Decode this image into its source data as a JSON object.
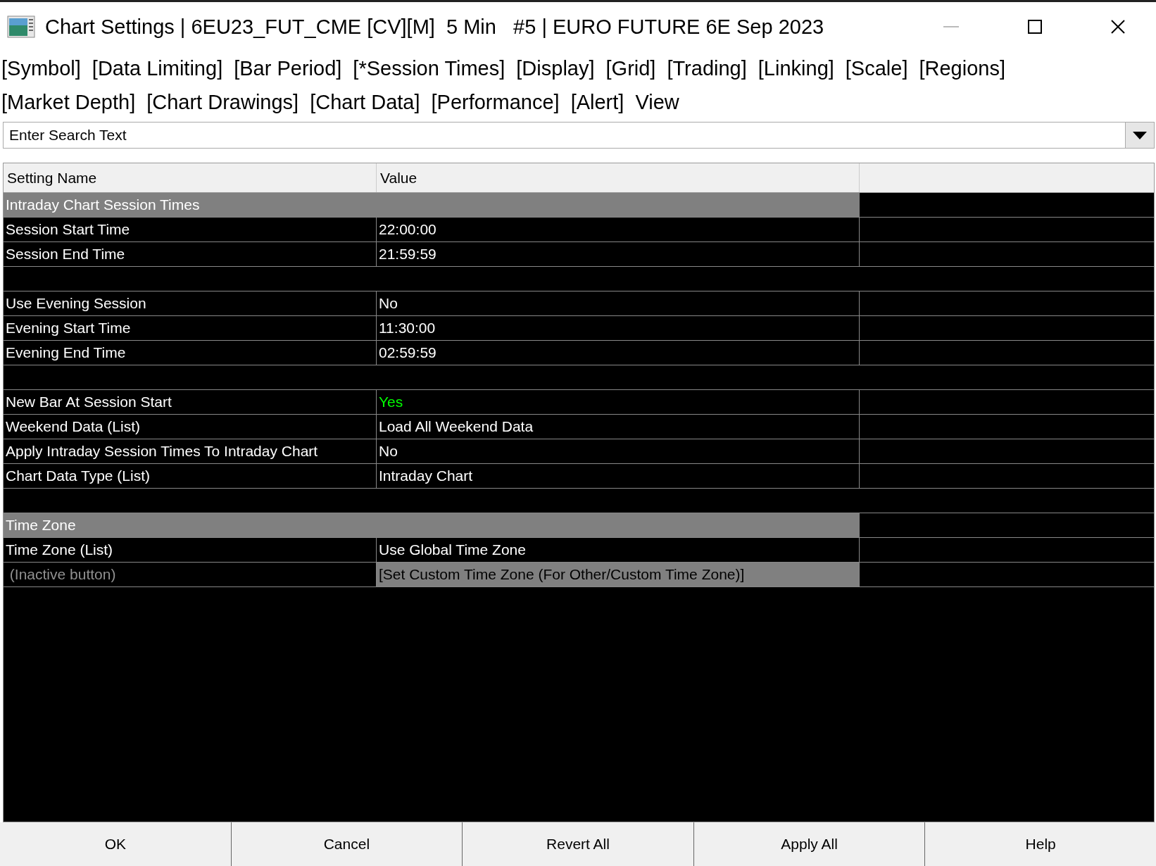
{
  "window": {
    "title": "Chart Settings | 6EU23_FUT_CME [CV][M]  5 Min   #5 | EURO FUTURE 6E Sep 2023"
  },
  "tab_rows": [
    [
      "[Symbol]",
      "[Data Limiting]",
      "[Bar Period]",
      "[*Session Times]",
      "[Display]",
      "[Grid]",
      "[Trading]",
      "[Linking]",
      "[Scale]",
      "[Regions]"
    ],
    [
      "[Market Depth]",
      "[Chart Drawings]",
      "[Chart Data]",
      "[Performance]",
      "[Alert]",
      "View"
    ]
  ],
  "search": {
    "placeholder": "Enter Search Text"
  },
  "table": {
    "columns": [
      "Setting Name",
      "Value"
    ],
    "rows": [
      {
        "kind": "section",
        "name": "Intraday Chart Session Times"
      },
      {
        "kind": "setting",
        "name": "Session Start Time",
        "value": "22:00:00",
        "color": "#ffffff"
      },
      {
        "kind": "setting",
        "name": "Session End Time",
        "value": "21:59:59",
        "color": "#ffffff"
      },
      {
        "kind": "blank"
      },
      {
        "kind": "setting",
        "name": "Use Evening Session",
        "value": "No",
        "color": "#ffffff"
      },
      {
        "kind": "setting",
        "name": "Evening Start Time",
        "value": "11:30:00",
        "color": "#ffffff"
      },
      {
        "kind": "setting",
        "name": "Evening End Time",
        "value": "02:59:59",
        "color": "#ffffff"
      },
      {
        "kind": "blank"
      },
      {
        "kind": "setting",
        "name": "New Bar At Session Start",
        "value": "Yes",
        "color": "#00ff00"
      },
      {
        "kind": "setting",
        "name": "Weekend Data (List)",
        "value": "Load All Weekend Data",
        "color": "#ffffff"
      },
      {
        "kind": "setting",
        "name": "Apply Intraday Session Times To Intraday Chart",
        "value": "No",
        "color": "#ffffff"
      },
      {
        "kind": "setting",
        "name": "Chart Data Type (List)",
        "value": "Intraday Chart",
        "color": "#ffffff"
      },
      {
        "kind": "blank"
      },
      {
        "kind": "section",
        "name": "Time Zone"
      },
      {
        "kind": "setting",
        "name": "Time Zone (List)",
        "value": "Use Global Time Zone",
        "color": "#ffffff"
      },
      {
        "kind": "button",
        "name": " (Inactive button)",
        "value": "[Set Custom Time Zone (For Other/Custom Time Zone)]",
        "disabled": true
      }
    ]
  },
  "buttons": [
    "OK",
    "Cancel",
    "Revert All",
    "Apply All",
    "Help"
  ]
}
